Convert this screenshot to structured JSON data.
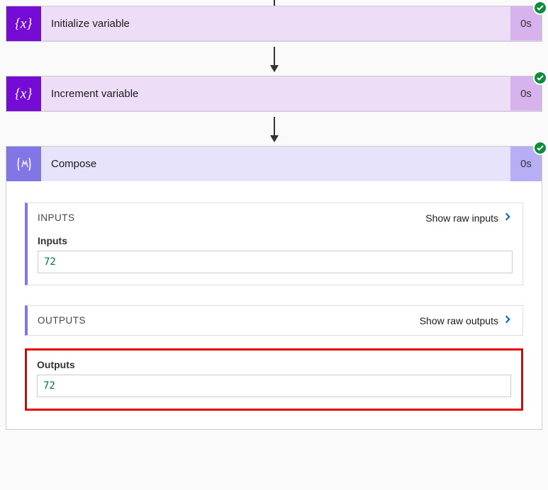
{
  "steps": [
    {
      "title": "Initialize variable",
      "duration": "0s"
    },
    {
      "title": "Increment variable",
      "duration": "0s"
    },
    {
      "title": "Compose",
      "duration": "0s"
    }
  ],
  "compose": {
    "inputs": {
      "header": "INPUTS",
      "raw_link": "Show raw inputs",
      "field_label": "Inputs",
      "value": "72"
    },
    "outputs": {
      "header": "OUTPUTS",
      "raw_link": "Show raw outputs",
      "field_label": "Outputs",
      "value": "72"
    }
  }
}
